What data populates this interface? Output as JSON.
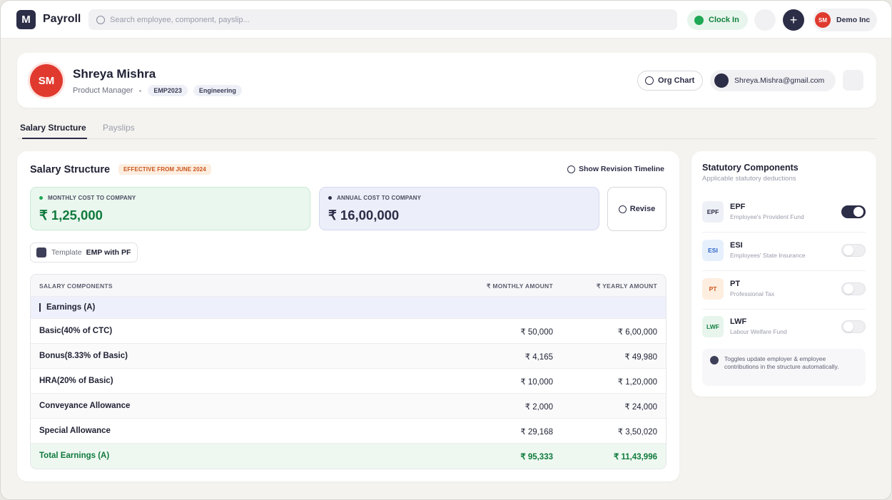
{
  "topbar": {
    "logo_letter": "M",
    "app_title": "Payroll",
    "search_placeholder": "Search employee, component, payslip...",
    "clock_in_label": "Clock In",
    "add_label": "+",
    "org_avatar": "SM",
    "org_name": "Demo Inc"
  },
  "profile": {
    "initials": "SM",
    "name": "Shreya Mishra",
    "role": "Product Manager",
    "employee_id": "EMP2023",
    "department": "Engineering",
    "org_chart_label": "Org Chart",
    "email": "Shreya.Mishra@gmail.com"
  },
  "tabs": [
    {
      "label": "Salary Structure",
      "active": true
    },
    {
      "label": "Payslips",
      "active": false
    }
  ],
  "salary": {
    "title": "Salary Structure",
    "effective_badge": "EFFECTIVE FROM JUNE 2024",
    "revision_link": "Show Revision Timeline",
    "monthly_ctc_label": "MONTHLY COST TO COMPANY",
    "monthly_ctc_value": "₹ 1,25,000",
    "annual_ctc_label": "ANNUAL COST TO COMPANY",
    "annual_ctc_value": "₹ 16,00,000",
    "revise_label": "Revise",
    "template_label": "Template",
    "template_value": "EMP with PF",
    "table": {
      "headers": [
        "SALARY COMPONENTS",
        "₹ MONTHLY AMOUNT",
        "₹ YEARLY AMOUNT"
      ],
      "group": "Earnings (A)",
      "rows": [
        {
          "name": "Basic",
          "note": "(40% of CTC)",
          "monthly": "₹ 50,000",
          "yearly": "₹ 6,00,000"
        },
        {
          "name": "Bonus",
          "note": "(8.33% of Basic)",
          "monthly": "₹ 4,165",
          "yearly": "₹ 49,980"
        },
        {
          "name": "HRA",
          "note": "(20% of Basic)",
          "monthly": "₹ 10,000",
          "yearly": "₹ 1,20,000"
        },
        {
          "name": "Conveyance Allowance",
          "note": "",
          "monthly": "₹ 2,000",
          "yearly": "₹ 24,000"
        },
        {
          "name": "Special Allowance",
          "note": "",
          "monthly": "₹ 29,168",
          "yearly": "₹ 3,50,020"
        }
      ],
      "total": {
        "name": "Total Earnings (A)",
        "monthly": "₹ 95,333",
        "yearly": "₹ 11,43,996"
      }
    }
  },
  "statutory": {
    "title": "Statutory Components",
    "subtitle": "Applicable statutory deductions",
    "items": [
      {
        "code": "EPF",
        "name": "EPF",
        "desc": "Employee's Provident Fund",
        "enabled": true,
        "badge_bg": "#eef0f7",
        "badge_fg": "#2c2d47"
      },
      {
        "code": "ESI",
        "name": "ESI",
        "desc": "Employees' State Insurance",
        "enabled": false,
        "badge_bg": "#e6f0fd",
        "badge_fg": "#2d63c8"
      },
      {
        "code": "PT",
        "name": "PT",
        "desc": "Professional Tax",
        "enabled": false,
        "badge_bg": "#fdeee0",
        "badge_fg": "#c9551c"
      },
      {
        "code": "LWF",
        "name": "LWF",
        "desc": "Labour Welfare Fund",
        "enabled": false,
        "badge_bg": "#e7f5ec",
        "badge_fg": "#14803f"
      }
    ],
    "note": "Toggles update employer & employee contributions in the structure automatically."
  }
}
